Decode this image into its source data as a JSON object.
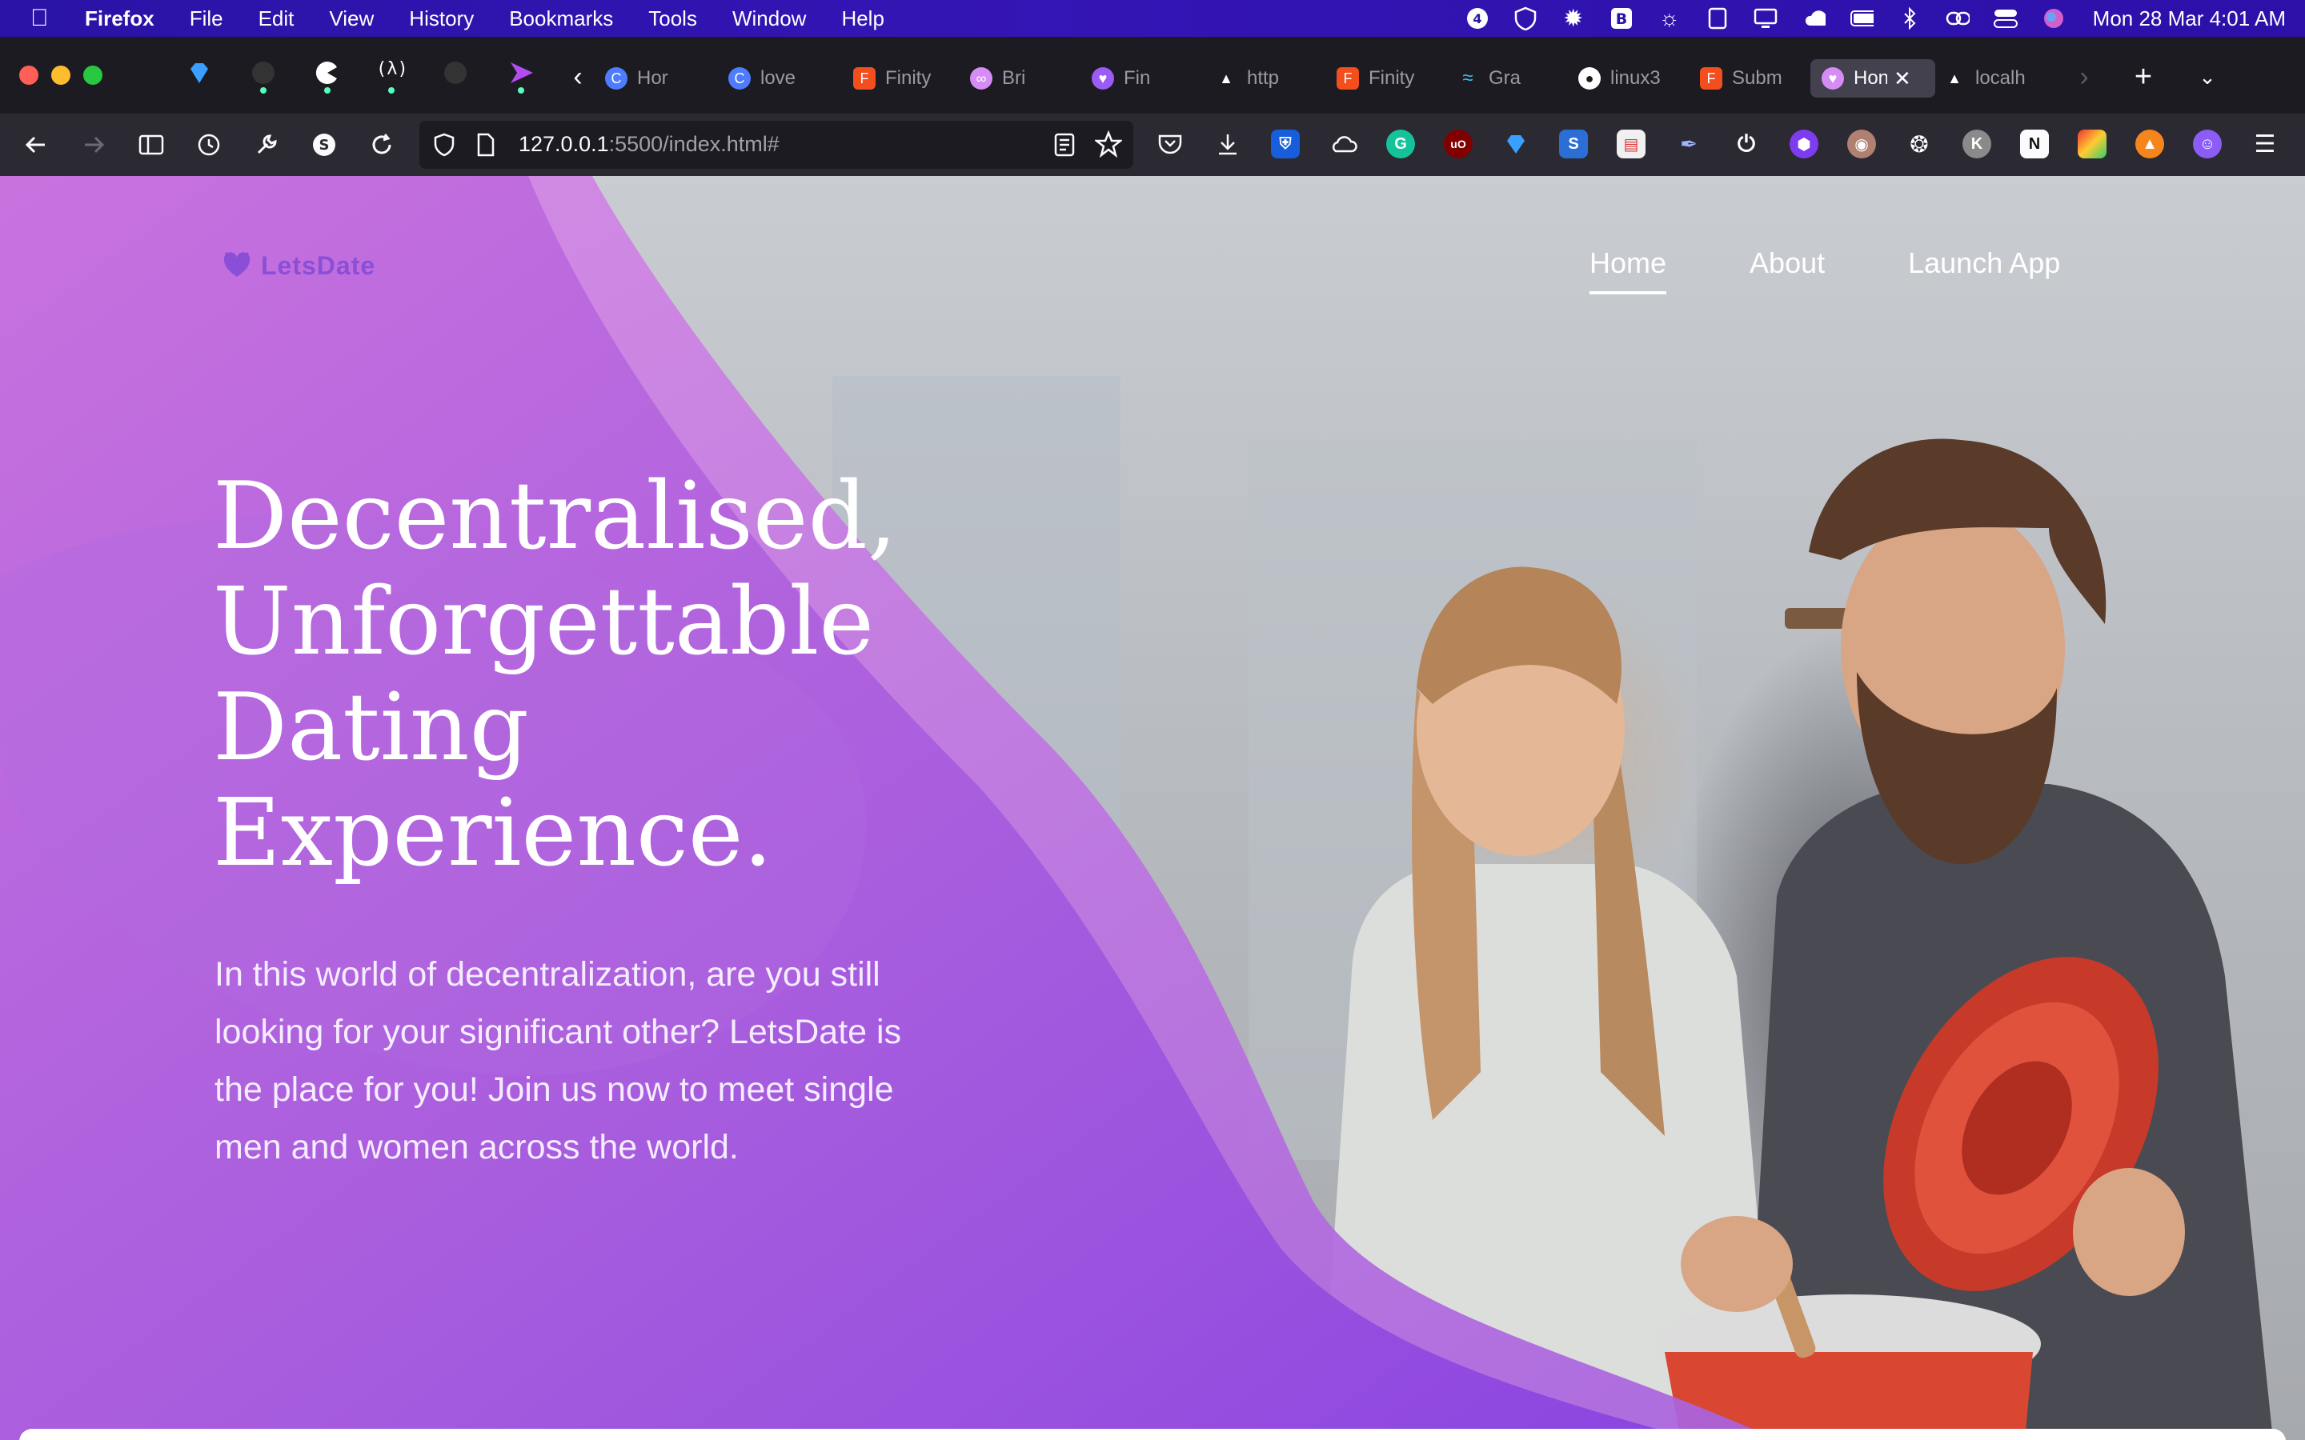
{
  "menubar": {
    "app_name": "Firefox",
    "menus": [
      "File",
      "Edit",
      "View",
      "History",
      "Bookmarks",
      "Tools",
      "Window",
      "Help"
    ],
    "clock": "Mon 28 Mar  4:01 AM"
  },
  "tabs": [
    {
      "title": "Hor",
      "favicon": "c-icon",
      "color": "#4f7cff"
    },
    {
      "title": "love",
      "favicon": "c-icon",
      "color": "#4f7cff"
    },
    {
      "title": "Finity",
      "favicon": "figma-icon",
      "color": "#f24e1e"
    },
    {
      "title": "Bri",
      "favicon": "link-icon",
      "color": "#d58df5"
    },
    {
      "title": "Fin",
      "favicon": "heart-icon",
      "color": "#9b5cf5"
    },
    {
      "title": "http",
      "favicon": "vercel-icon",
      "color": "#ffffff"
    },
    {
      "title": "Finity",
      "favicon": "figma-icon",
      "color": "#f24e1e"
    },
    {
      "title": "Gra",
      "favicon": "tailwind-icon",
      "color": "#38bdf8"
    },
    {
      "title": "linux3",
      "favicon": "github-icon",
      "color": "#ffffff"
    },
    {
      "title": "Subm",
      "favicon": "figma-icon",
      "color": "#f24e1e"
    },
    {
      "title": "Hon",
      "favicon": "heart-icon",
      "color": "#d58df5",
      "active": true
    },
    {
      "title": "localh",
      "favicon": "vercel-icon",
      "color": "#ffffff"
    }
  ],
  "urlbar": {
    "host": "127.0.0.1",
    "rest": ":5500/index.html#"
  },
  "page": {
    "brand": "LetsDate",
    "nav": [
      "Home",
      "About",
      "Launch App"
    ],
    "active_nav": "Home",
    "hero_title": "Decentralised, Unforgettable Dating Experience.",
    "hero_text": "In this world of decentralization, are you still looking for your significant other? LetsDate is the place for you! Join us now to meet single men and women across the world.",
    "colors": {
      "purple_light": "#c77de0",
      "purple_mid": "#a35ee0",
      "purple_deep": "#8a45e0",
      "brand": "#8a4fd6"
    }
  }
}
